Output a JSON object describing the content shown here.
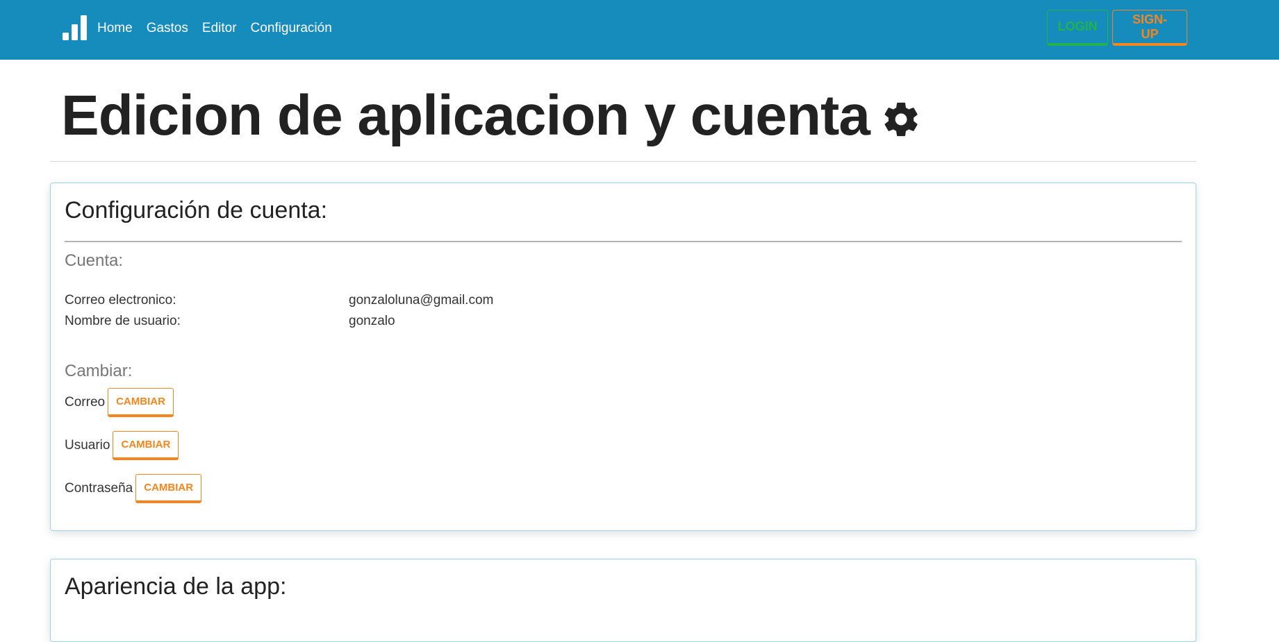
{
  "navbar": {
    "brand_icon": "bar-chart-icon",
    "links": [
      "Home",
      "Gastos",
      "Editor",
      "Configuración"
    ],
    "login_label": "LOGIN",
    "signup_label": "SIGN-UP",
    "colors": {
      "background": "#168cbd",
      "login": "#22b34a",
      "signup": "#f5861f"
    }
  },
  "header": {
    "title": "Edicion de aplicacion y cuenta",
    "icon": "gear-icon"
  },
  "account": {
    "title": "Configuración de cuenta:",
    "cuenta_subtitle": "Cuenta:",
    "email_label": "Correo electronico:",
    "email_value": "gonzaloluna@gmail.com",
    "username_label": "Nombre de usuario:",
    "username_value": "gonzalo",
    "change_subtitle": "Cambiar:",
    "changes": [
      {
        "label": "Correo",
        "button": "CAMBIAR"
      },
      {
        "label": "Usuario",
        "button": "CAMBIAR"
      },
      {
        "label": "Contraseña",
        "button": "CAMBIAR"
      }
    ]
  },
  "appearance": {
    "title": "Apariencia de la app:"
  }
}
